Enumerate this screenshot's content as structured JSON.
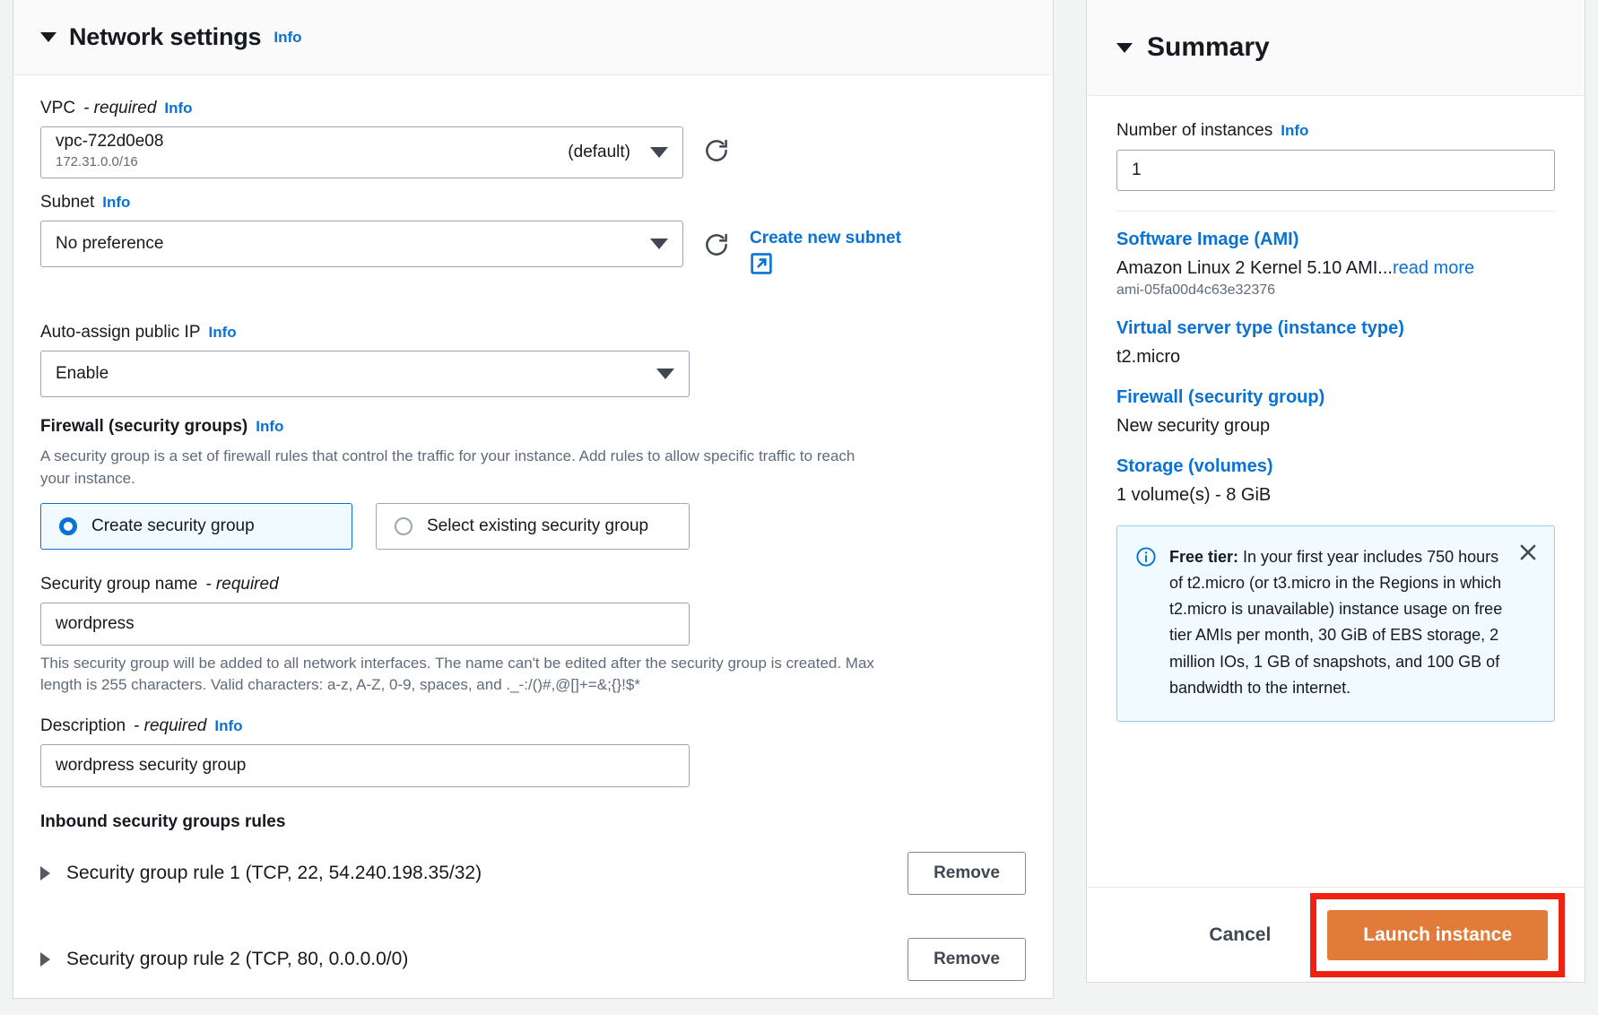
{
  "network_settings": {
    "title": "Network settings",
    "info_label": "Info",
    "vpc": {
      "label": "VPC",
      "required_text": "- required",
      "info_label": "Info",
      "value": "vpc-722d0e08",
      "cidr": "172.31.0.0/16",
      "suffix": "(default)",
      "refresh_icon": "refresh-icon"
    },
    "subnet": {
      "label": "Subnet",
      "info_label": "Info",
      "value": "No preference",
      "create_link": "Create new subnet",
      "external_icon": "external-link-icon",
      "refresh_icon": "refresh-icon"
    },
    "auto_assign_ip": {
      "label": "Auto-assign public IP",
      "info_label": "Info",
      "value": "Enable"
    },
    "firewall": {
      "label": "Firewall (security groups)",
      "info_label": "Info",
      "description": "A security group is a set of firewall rules that control the traffic for your instance. Add rules to allow specific traffic to reach your instance.",
      "options": [
        {
          "label": "Create security group",
          "selected": true
        },
        {
          "label": "Select existing security group",
          "selected": false
        }
      ]
    },
    "sg_name": {
      "label": "Security group name",
      "required_text": "- required",
      "value": "wordpress",
      "helper": "This security group will be added to all network interfaces. The name can't be edited after the security group is created. Max length is 255 characters. Valid characters: a-z, A-Z, 0-9, spaces, and ._-:/()#,@[]+=&;{}!$*"
    },
    "sg_description": {
      "label": "Description",
      "required_text": "- required",
      "info_label": "Info",
      "value": "wordpress security group"
    },
    "inbound_rules": {
      "heading": "Inbound security groups rules",
      "rules": [
        {
          "title": "Security group rule 1 (TCP, 22, 54.240.198.35/32)",
          "remove_label": "Remove"
        },
        {
          "title": "Security group rule 2 (TCP, 80, 0.0.0.0/0)",
          "remove_label": "Remove"
        }
      ]
    }
  },
  "summary": {
    "title": "Summary",
    "number_of_instances": {
      "label": "Number of instances",
      "info_label": "Info",
      "value": "1"
    },
    "items": [
      {
        "link": "Software Image (AMI)",
        "value": "Amazon Linux 2 Kernel 5.10 AMI...",
        "read_more": "read more",
        "sub": "ami-05fa00d4c63e32376"
      },
      {
        "link": "Virtual server type (instance type)",
        "value": "t2.micro",
        "read_more": "",
        "sub": ""
      },
      {
        "link": "Firewall (security group)",
        "value": "New security group",
        "read_more": "",
        "sub": ""
      },
      {
        "link": "Storage (volumes)",
        "value": "1 volume(s) - 8 GiB",
        "read_more": "",
        "sub": ""
      }
    ],
    "free_tier": {
      "bold_prefix": "Free tier:",
      "text": " In your first year includes 750 hours of t2.micro (or t3.micro in the Regions in which t2.micro is unavailable) instance usage on free tier AMIs per month, 30 GiB of EBS storage, 2 million IOs, 1 GB of snapshots, and 100 GB of bandwidth to the internet.",
      "info_icon": "info-circle-icon",
      "close_icon": "close-icon"
    },
    "cancel_label": "Cancel",
    "launch_label": "Launch instance"
  },
  "colors": {
    "link_blue": "#0972d3",
    "launch_orange": "#e07b39",
    "highlight_red": "#ee2211",
    "alert_bg": "#f1faff"
  }
}
